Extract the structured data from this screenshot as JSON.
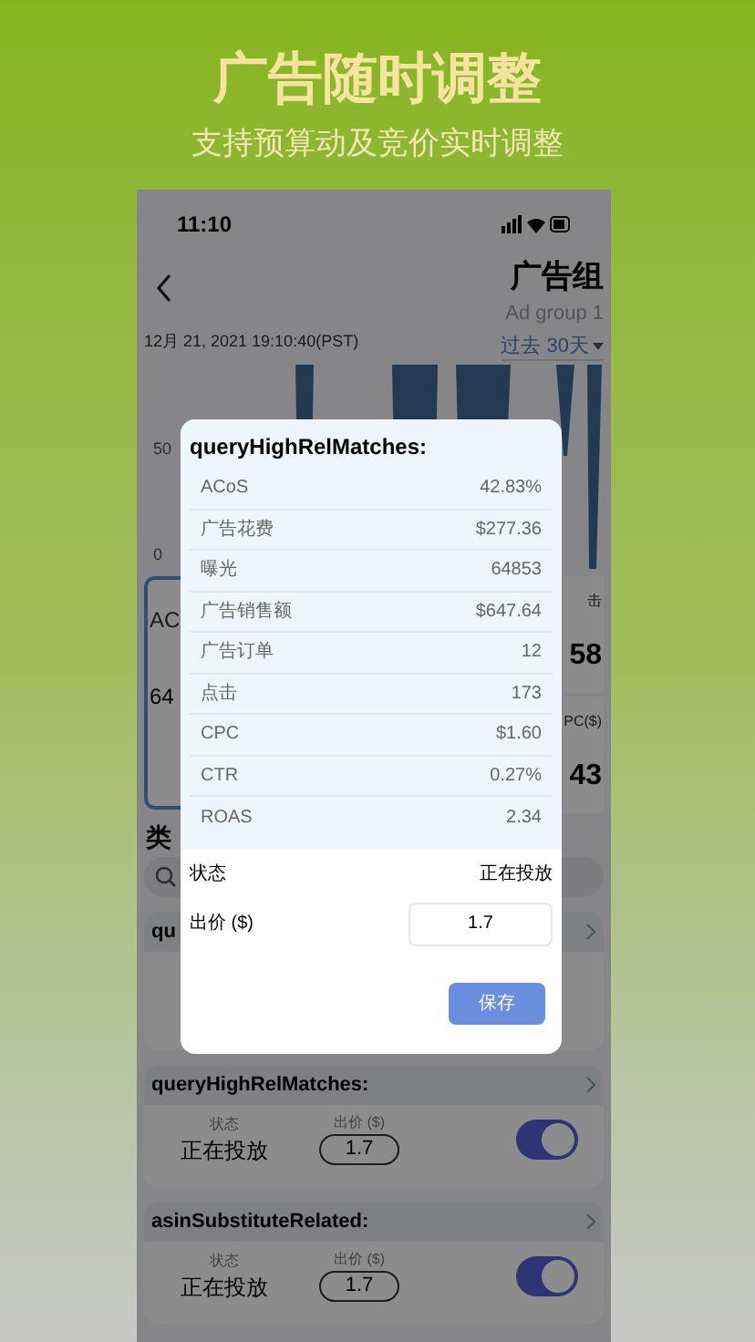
{
  "banner": {
    "title": "广告随时调整",
    "subtitle": "支持预算动及竞价实时调整"
  },
  "status_bar": {
    "time": "11:10"
  },
  "header": {
    "title": "广告组",
    "subtitle": "Ad group 1",
    "timestamp": "12月 21, 2021 19:10:40(PST)",
    "range": "过去 30天"
  },
  "chart": {
    "y_labels": [
      "50",
      "0"
    ]
  },
  "left_card": {
    "label": "AC",
    "value": "64"
  },
  "right_cards": [
    {
      "label": "击",
      "value": "58"
    },
    {
      "label": "PC($)",
      "value": "43"
    }
  ],
  "section_title": "类",
  "partial_card": {
    "title": "qu"
  },
  "keywords": [
    {
      "name": "queryHighRelMatches:",
      "status_label": "状态",
      "status": "正在投放",
      "bid_label": "出价 ($)",
      "bid": "1.7",
      "on": true
    },
    {
      "name": "asinSubstituteRelated:",
      "status_label": "状态",
      "status": "正在投放",
      "bid_label": "出价 ($)",
      "bid": "1.7",
      "on": true
    }
  ],
  "dialog": {
    "title": "queryHighRelMatches:",
    "metrics": [
      {
        "label": "ACoS",
        "value": "42.83%"
      },
      {
        "label": "广告花费",
        "value": "$277.36"
      },
      {
        "label": "曝光",
        "value": "64853"
      },
      {
        "label": "广告销售额",
        "value": "$647.64"
      },
      {
        "label": "广告订单",
        "value": "12"
      },
      {
        "label": "点击",
        "value": "173"
      },
      {
        "label": "CPC",
        "value": "$1.60"
      },
      {
        "label": "CTR",
        "value": "0.27%"
      },
      {
        "label": "ROAS",
        "value": "2.34"
      }
    ],
    "status_label": "状态",
    "status": "正在投放",
    "bid_label": "出价 ($)",
    "bid": "1.7",
    "save": "保存"
  }
}
